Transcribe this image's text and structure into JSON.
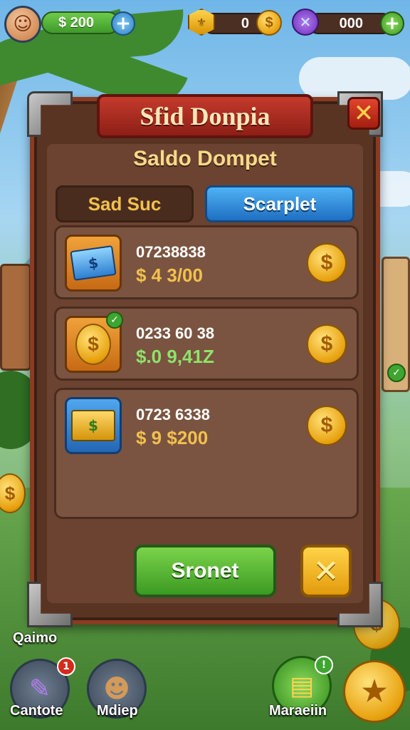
{
  "hud": {
    "cash": "$ 200",
    "gold_count": "0",
    "gem_count": "000"
  },
  "dialog": {
    "title": "Sfid Donpia",
    "subtitle": "Saldo Dompet",
    "tabs": [
      {
        "label": "Sad Suc",
        "active": false
      },
      {
        "label": "Scarplet",
        "active": true
      }
    ],
    "rows": [
      {
        "id": "07238838",
        "amount": "$ 4 3/00",
        "amount_color": "#f2c14e",
        "icon": "cash-stack-icon"
      },
      {
        "id": "0233 60 38",
        "amount": "$.0 9,41Z",
        "amount_color": "#8fe36a",
        "icon": "coin-icon"
      },
      {
        "id": "0723 6338",
        "amount": "$ 9 $200",
        "amount_color": "#f2c14e",
        "icon": "money-bundle-icon"
      }
    ],
    "confirm_label": "Sronet",
    "cancel_symbol": "✕",
    "close_symbol": "✕"
  },
  "nav": {
    "left_label": "Qaimo",
    "items": [
      {
        "label": "Cantote",
        "badge": "1"
      },
      {
        "label": "Mdiep"
      },
      {
        "label": "Maraeiin"
      }
    ]
  },
  "colors": {
    "accent_green": "#3f9a2a",
    "accent_blue": "#1f6fc2",
    "panel_brown": "#5a3422",
    "banner_red": "#c43a2c",
    "gold": "#e8a10e"
  }
}
